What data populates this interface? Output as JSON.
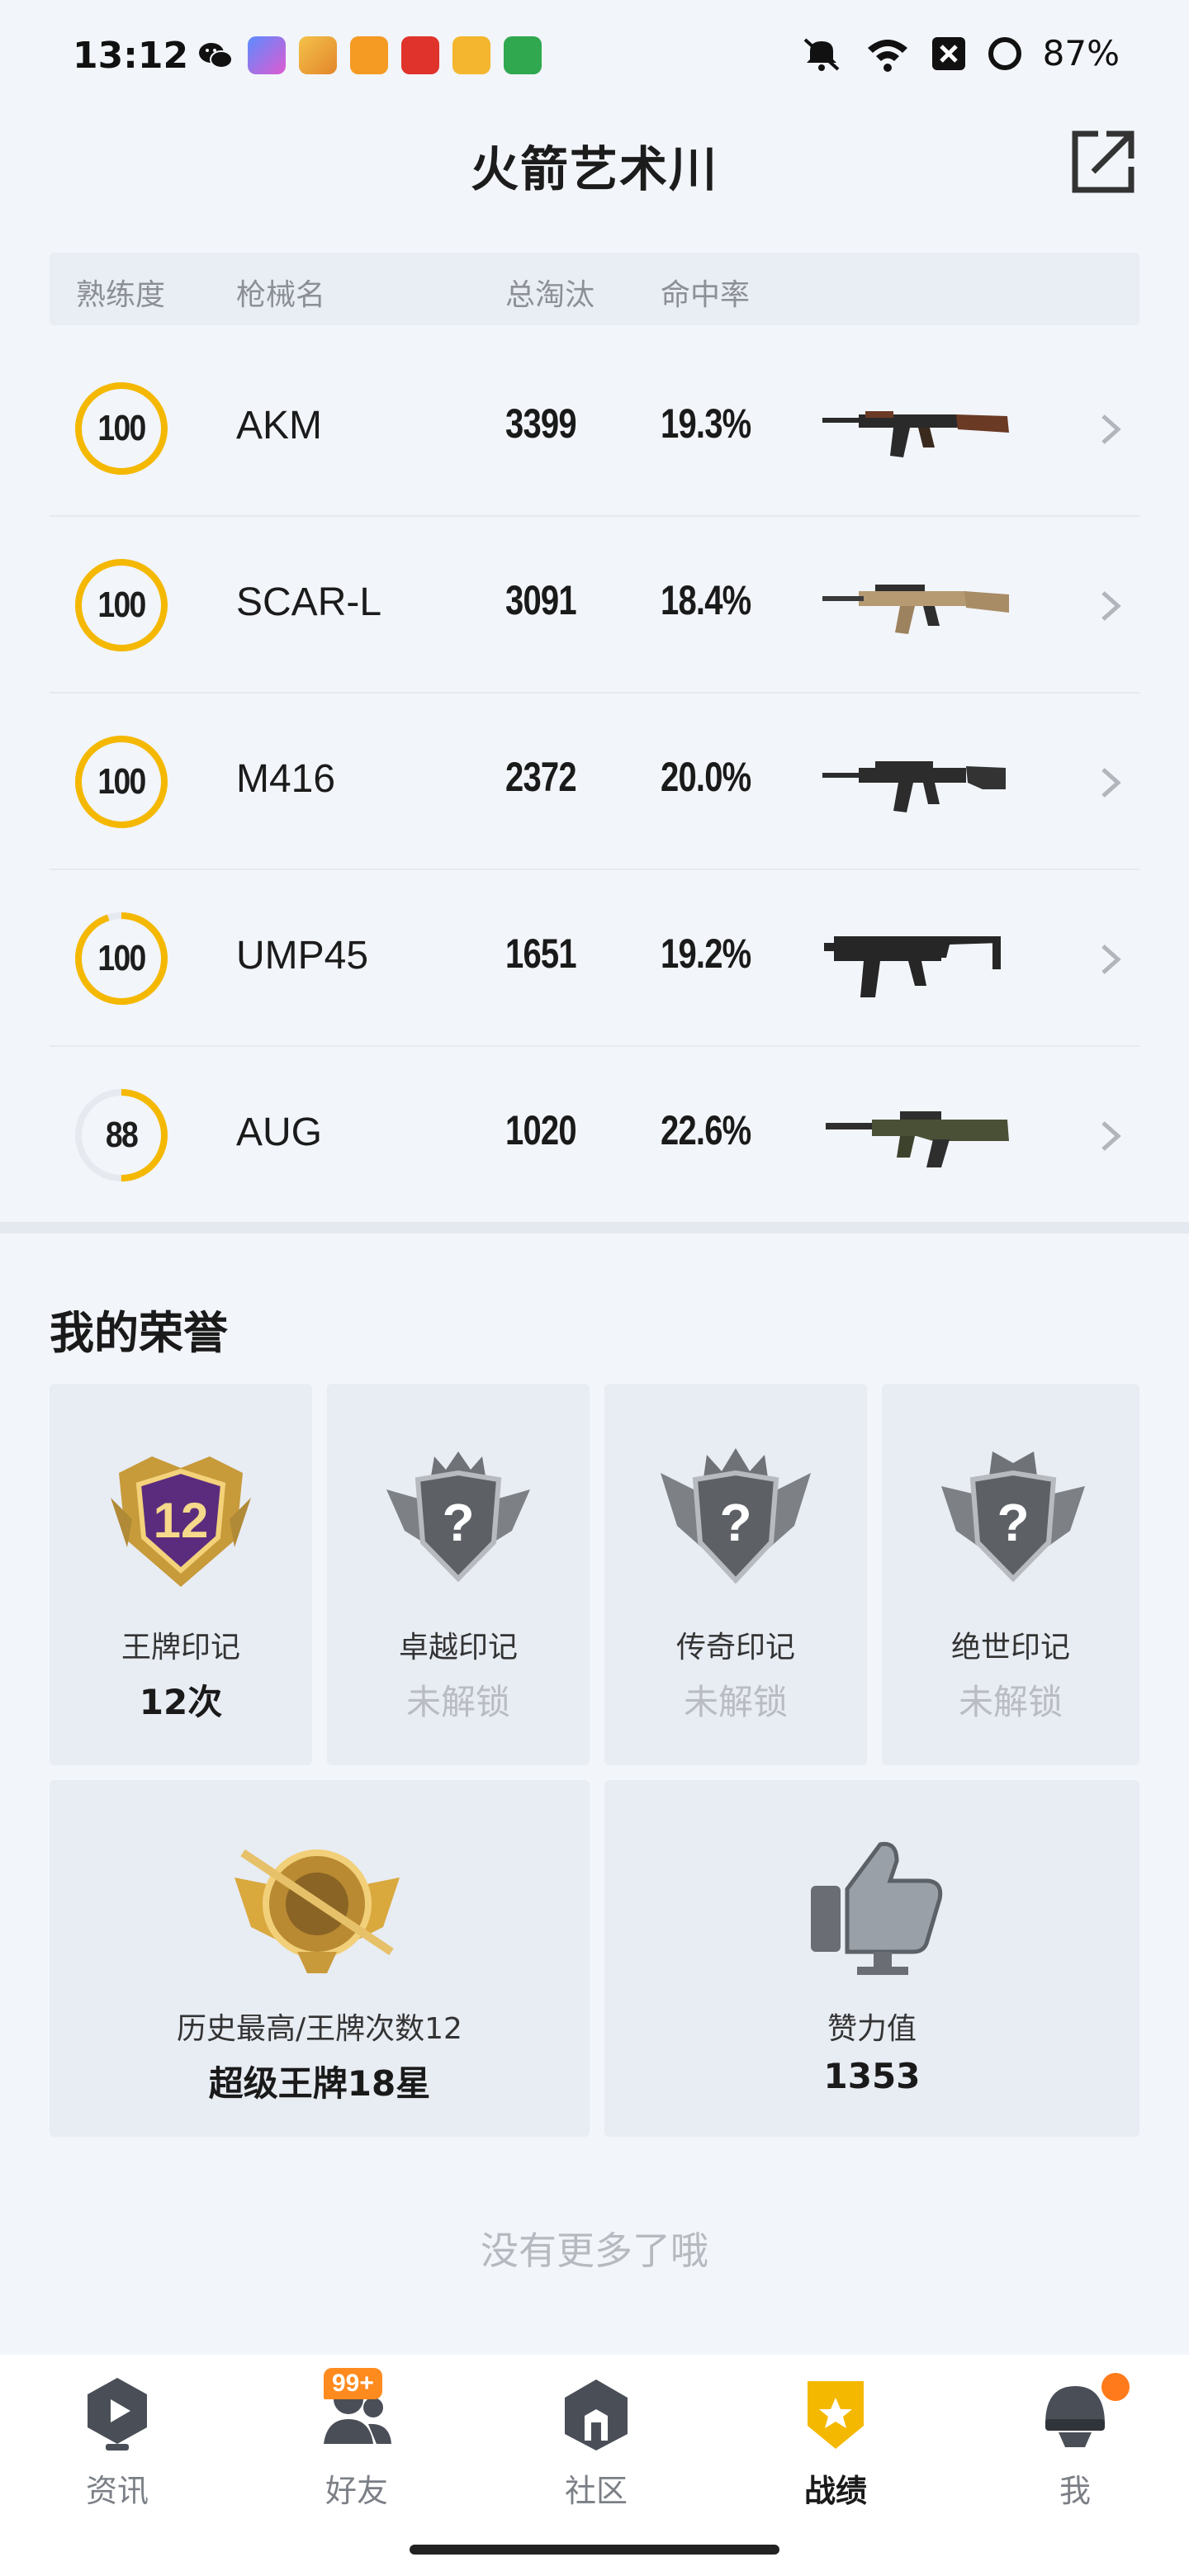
{
  "status_bar": {
    "time": "13:12",
    "battery": "87%",
    "icons": [
      "wechat-icon",
      "game-app-icon",
      "store-app-icon",
      "video-app-icon",
      "notes-app-icon",
      "music-app-icon",
      "oppo-store-icon",
      "mute-icon",
      "wifi-icon",
      "close-box-icon",
      "ring-icon"
    ]
  },
  "header": {
    "title": "火箭艺术川",
    "share_icon": "share-external-icon"
  },
  "table": {
    "headers": {
      "mastery": "熟练度",
      "name": "枪械名",
      "kills": "总淘汰",
      "accuracy": "命中率"
    },
    "rows": [
      {
        "mastery": "100",
        "mastery_fraction": 1.0,
        "name": "AKM",
        "kills": "3399",
        "accuracy": "19.3%",
        "gun_icon": "akm-rifle-icon"
      },
      {
        "mastery": "100",
        "mastery_fraction": 1.0,
        "name": "SCAR-L",
        "kills": "3091",
        "accuracy": "18.4%",
        "gun_icon": "scar-l-rifle-icon"
      },
      {
        "mastery": "100",
        "mastery_fraction": 1.0,
        "name": "M416",
        "kills": "2372",
        "accuracy": "20.0%",
        "gun_icon": "m416-rifle-icon"
      },
      {
        "mastery": "100",
        "mastery_fraction": 0.95,
        "name": "UMP45",
        "kills": "1651",
        "accuracy": "19.2%",
        "gun_icon": "ump45-smg-icon"
      },
      {
        "mastery": "88",
        "mastery_fraction": 0.5,
        "name": "AUG",
        "kills": "1020",
        "accuracy": "22.6%",
        "gun_icon": "aug-rifle-icon"
      }
    ]
  },
  "honors": {
    "title": "我的荣誉",
    "cards": [
      {
        "label": "王牌印记",
        "value": "12次",
        "locked": false,
        "emblem_text": "12",
        "icon": "ace-emblem-icon"
      },
      {
        "label": "卓越印记",
        "value": "未解锁",
        "locked": true,
        "emblem_text": "?",
        "icon": "excellence-emblem-icon"
      },
      {
        "label": "传奇印记",
        "value": "未解锁",
        "locked": true,
        "emblem_text": "?",
        "icon": "legend-emblem-icon"
      },
      {
        "label": "绝世印记",
        "value": "未解锁",
        "locked": true,
        "emblem_text": "?",
        "icon": "peerless-emblem-icon"
      }
    ],
    "big_cards": [
      {
        "label": "历史最高/王牌次数12",
        "value": "超级王牌18星",
        "icon": "super-ace-rank-icon"
      },
      {
        "label": "赞力值",
        "value": "1353",
        "icon": "thumbs-up-trophy-icon"
      }
    ]
  },
  "footer": {
    "no_more": "没有更多了哦"
  },
  "nav": {
    "items": [
      {
        "label": "资讯",
        "icon": "news-play-icon",
        "active": false
      },
      {
        "label": "好友",
        "icon": "friends-icon",
        "active": false,
        "badge": "99+"
      },
      {
        "label": "社区",
        "icon": "community-icon",
        "active": false
      },
      {
        "label": "战绩",
        "icon": "record-badge-icon",
        "active": true
      },
      {
        "label": "我",
        "icon": "helmet-avatar-icon",
        "active": false
      }
    ]
  },
  "colors": {
    "accent": "#f5b800",
    "ring_track": "#e6e9ef",
    "text_muted": "#8c8f96",
    "locked_text": "#b9bcc2",
    "badge": "#ff8a1d"
  }
}
